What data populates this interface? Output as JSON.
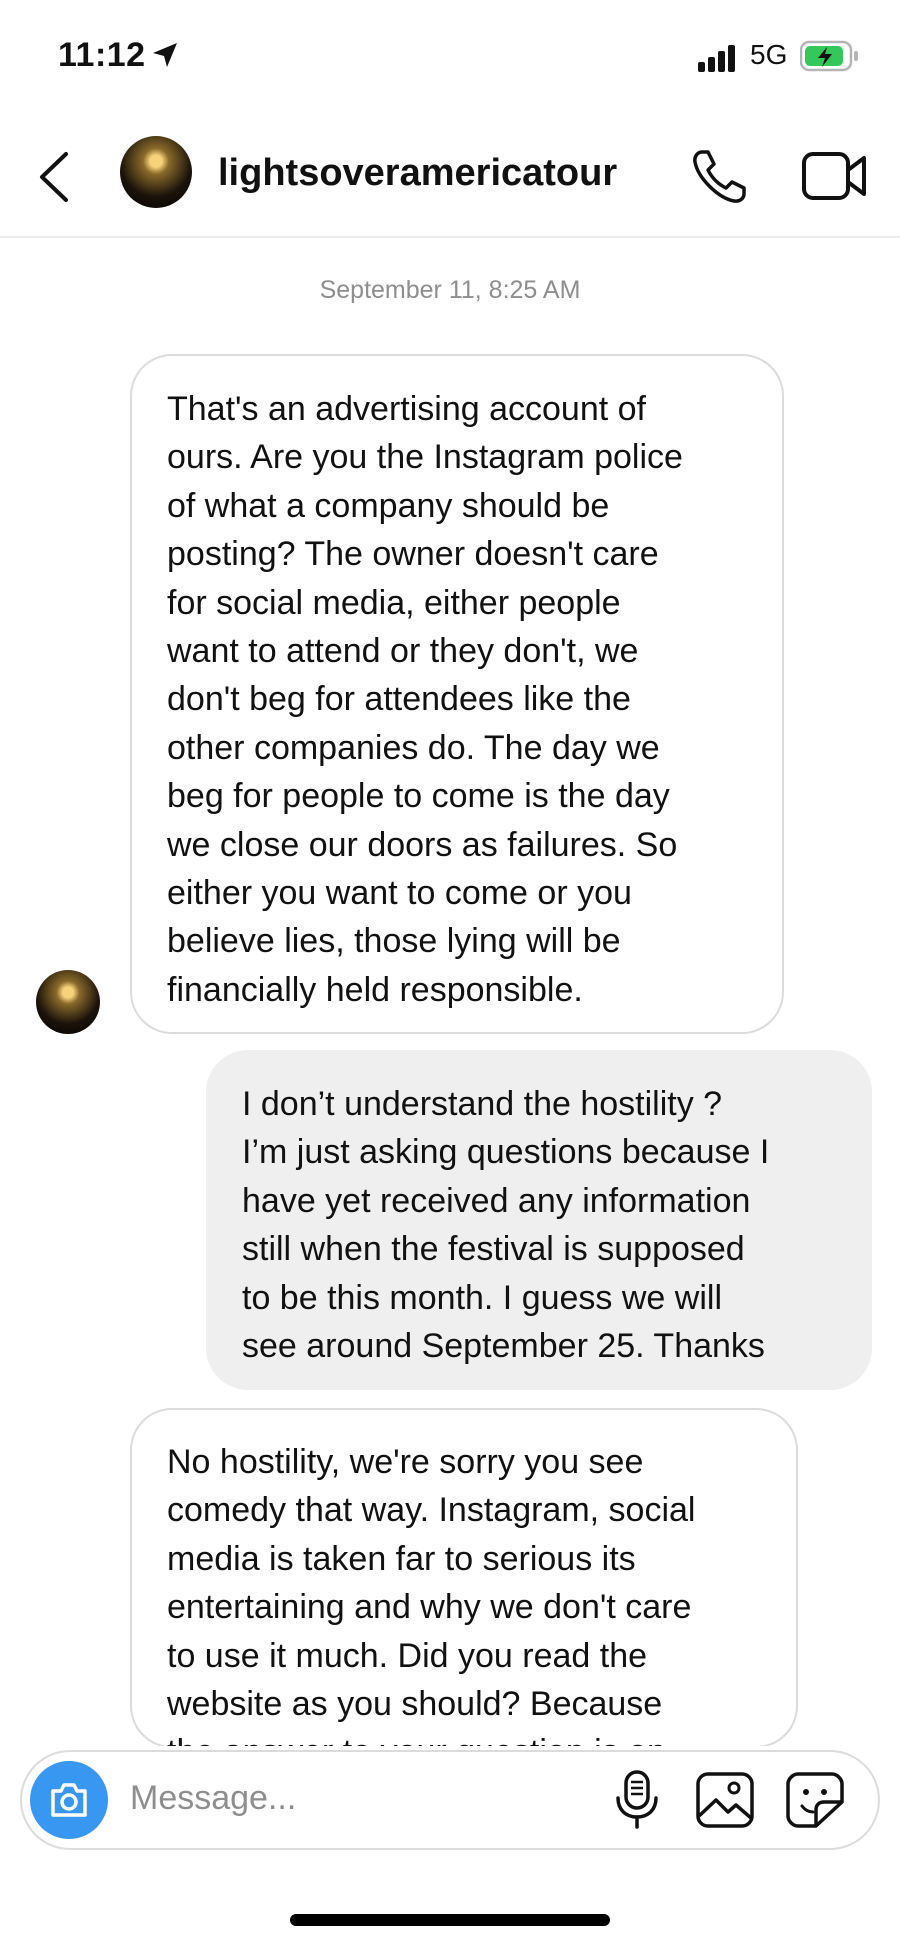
{
  "status_bar": {
    "time": "11:12",
    "network": "5G",
    "icons": [
      "location-arrow-icon",
      "signal-bars-icon",
      "battery-charging-icon"
    ]
  },
  "header": {
    "username": "lightsoveramericatour",
    "icons": [
      "back-chevron-icon",
      "phone-icon",
      "video-camera-icon"
    ]
  },
  "thread": {
    "timestamp": "September 11, 8:25 AM",
    "messages": [
      {
        "sender": "lightsoveramericatour",
        "lines": [
          "That's an advertising account of",
          "ours. Are you the Instagram police",
          "of what a company should be",
          "posting? The owner doesn't care",
          "for social media, either people",
          "want to attend or they don't, we",
          "don't beg for attendees like the",
          "other companies do. The day we",
          "beg for people to come is the day",
          "we close our doors as failures. So",
          "either you want to come or you",
          "believe lies, those lying will be",
          "financially held responsible."
        ]
      },
      {
        "sender": "me",
        "lines": [
          "I don’t understand the hostility ?",
          "I’m just asking questions because I",
          "have yet received any information",
          "still when the festival is supposed",
          "to be this month. I guess we will",
          "see around September 25. Thanks"
        ]
      },
      {
        "sender": "lightsoveramericatour",
        "lines": [
          "No hostility, we're sorry you see",
          "comedy that way. Instagram, social",
          "media is taken far to serious its",
          "entertaining and why we don't care",
          "to use it much. Did you read the",
          "website as you should? Because",
          "the answer to your question is on"
        ]
      }
    ]
  },
  "composer": {
    "placeholder": "Message...",
    "icons": [
      "camera-icon",
      "microphone-icon",
      "gallery-icon",
      "sticker-icon"
    ]
  },
  "colors": {
    "camera_button": "#3897f0",
    "outgoing_bubble": "#efefef",
    "incoming_border": "#dbdbdb",
    "battery_fill": "#34c759"
  }
}
